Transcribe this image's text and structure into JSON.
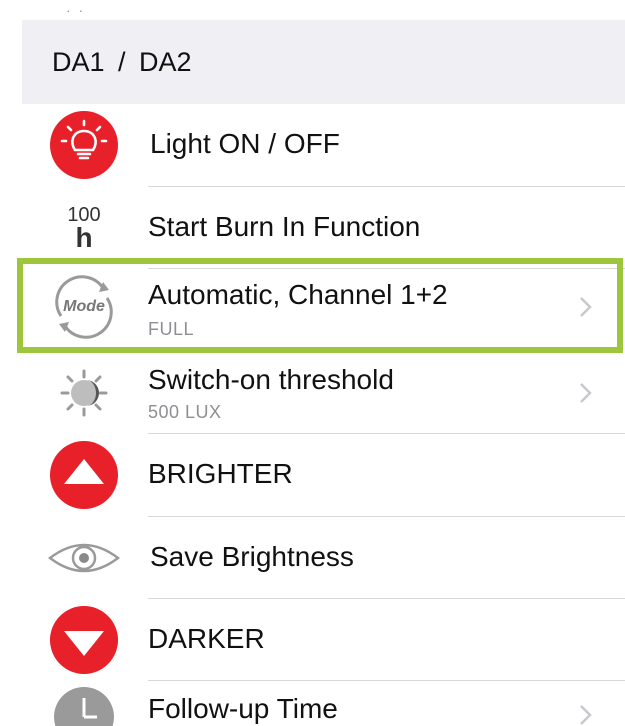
{
  "header": {
    "title": "DA1  /  DA2",
    "top_partial": "· ·"
  },
  "rows": [
    {
      "label": "Light ON / OFF",
      "icon": "light-bulb-icon",
      "has_chevron": false
    },
    {
      "label": "Start Burn In Function",
      "icon": "burn-in-100h-icon",
      "icon_text_top": "100",
      "icon_text_bottom": "h",
      "has_chevron": false
    },
    {
      "label": "Automatic, Channel 1+2",
      "sub": "FULL",
      "icon": "mode-icon",
      "icon_text": "Mode",
      "has_chevron": true,
      "highlighted": true
    },
    {
      "label": "Switch-on threshold",
      "sub": "500 LUX",
      "icon": "day-night-threshold-icon",
      "has_chevron": true
    },
    {
      "label": "BRIGHTER",
      "icon": "arrow-up-icon",
      "has_chevron": false
    },
    {
      "label": "Save Brightness",
      "icon": "eye-icon",
      "has_chevron": false
    },
    {
      "label": "DARKER",
      "icon": "arrow-down-icon",
      "has_chevron": false
    },
    {
      "label": "Follow-up Time",
      "icon": "clock-icon",
      "has_chevron": true
    }
  ],
  "colors": {
    "accent_red": "#e8202a",
    "highlight_green": "#9dc63c",
    "icon_gray": "#8e8e93"
  }
}
